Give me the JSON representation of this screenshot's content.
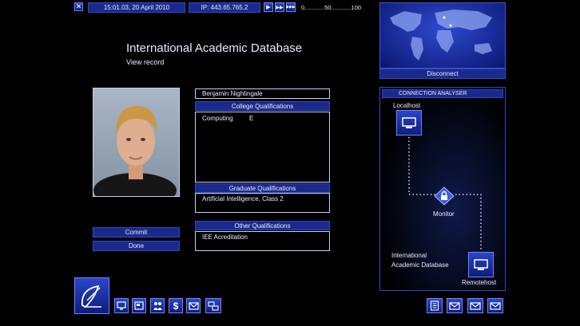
{
  "topbar": {
    "datetime": "15:01.03, 20 April 2010",
    "ip": "IP: 443.65.765.2",
    "speed_scale": "0............50............100",
    "play_icons": [
      "play-icon",
      "fast-forward-icon",
      "fastest-icon"
    ]
  },
  "main": {
    "title": "International Academic Database",
    "subtitle": "View record"
  },
  "record": {
    "name": "Benjamin Nightingale",
    "college_header": "College Qualifications",
    "college_subject": "Computing",
    "college_grade": "E",
    "graduate_header": "Graduate Qualifications",
    "graduate_value": "Artificial Intelligence, Class 2",
    "other_header": "Other Qualifications",
    "other_value": "IEE Acreditation"
  },
  "actions": {
    "commit": "Commit",
    "done": "Done"
  },
  "worldmap": {
    "disconnect": "Disconnect"
  },
  "connection": {
    "header": "CONNECTION ANALYSER",
    "localhost": "Localhost",
    "monitor": "Monitor",
    "target_line1": "International",
    "target_line2": "Academic Database",
    "remotehost": "Remotehost"
  },
  "bottom_icons_left": [
    "satellite-dish-icon",
    "computer-icon",
    "software-icon",
    "people-icon",
    "finance-icon",
    "mail-icon",
    "system-icon"
  ],
  "bottom_icons_right": [
    "notes-icon",
    "email-icon",
    "email-icon",
    "email-icon"
  ],
  "colors": {
    "panel_blue": "#1a2a8c",
    "accent_blue": "#2f47c4",
    "background": "#000000"
  }
}
